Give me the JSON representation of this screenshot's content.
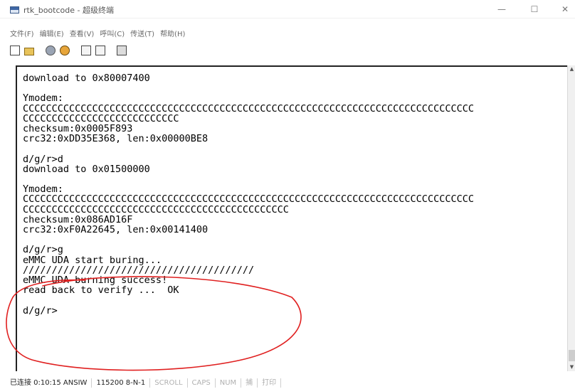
{
  "window": {
    "title": "rtk_bootcode - 超级终端",
    "minimize_glyph": "—",
    "maximize_glyph": "☐",
    "close_glyph": "✕"
  },
  "menu": {
    "items": [
      "文件(F)",
      "编辑(E)",
      "查看(V)",
      "呼叫(C)",
      "传送(T)",
      "帮助(H)"
    ]
  },
  "toolbar": {
    "icons": [
      "new-file-icon",
      "open-folder-icon",
      "connect-icon",
      "disconnect-icon",
      "send-file-icon",
      "receive-file-icon",
      "properties-icon"
    ]
  },
  "terminal": {
    "lines": [
      "download to 0x80007400",
      "",
      "Ymodem:",
      "CCCCCCCCCCCCCCCCCCCCCCCCCCCCCCCCCCCCCCCCCCCCCCCCCCCCCCCCCCCCCCCCCCCCCCCCCCCCCC",
      "CCCCCCCCCCCCCCCCCCCCCCCCCCC",
      "checksum:0x0005F893",
      "crc32:0xDD35E368, len:0x00000BE8",
      "",
      "d/g/r>d",
      "download to 0x01500000",
      "",
      "Ymodem:",
      "CCCCCCCCCCCCCCCCCCCCCCCCCCCCCCCCCCCCCCCCCCCCCCCCCCCCCCCCCCCCCCCCCCCCCCCCCCCCCC",
      "CCCCCCCCCCCCCCCCCCCCCCCCCCCCCCCCCCCCCCCCCCCCCC",
      "checksum:0x086AD16F",
      "crc32:0xF0A22645, len:0x00141400",
      "",
      "d/g/r>g",
      "eMMC UDA start buring...",
      "////////////////////////////////////////",
      "eMMC UDA burning success!",
      "read back to verify ...  OK",
      "",
      "d/g/r>"
    ]
  },
  "status": {
    "connected": "已连接 0:10:15",
    "emulation": "ANSIW",
    "port_settings": "115200 8-N-1",
    "scroll": "SCROLL",
    "caps": "CAPS",
    "num": "NUM",
    "capture": "捕",
    "print": "打印"
  },
  "colors": {
    "annotation": "#e02020",
    "terminal_bg": "#ffffff",
    "terminal_text": "#000000"
  }
}
